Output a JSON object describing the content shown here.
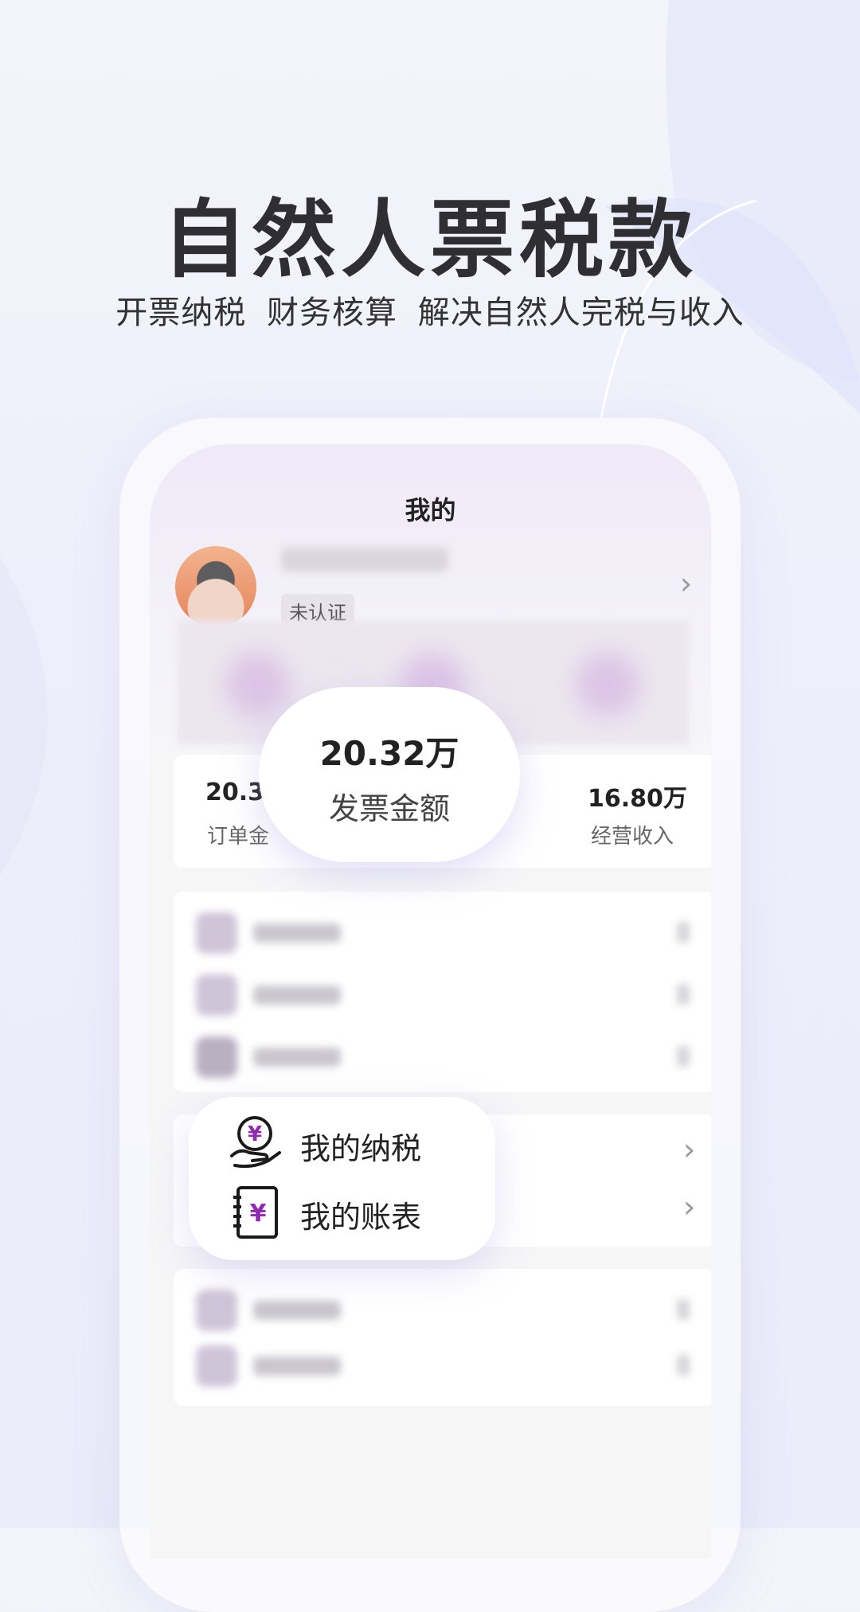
{
  "hero": {
    "title": "自然人票税款",
    "subtitle": "开票纳税  财务核算  解决自然人完税与收入"
  },
  "screen": {
    "title": "我的",
    "user": {
      "name": "",
      "status_badge": "未认证"
    },
    "stats": {
      "left": {
        "value": "20.3",
        "label": "订单金"
      },
      "right": {
        "value": "16.80万",
        "label": "经营收入"
      }
    }
  },
  "highlight_bubble": {
    "value": "20.32万",
    "label": "发票金额"
  },
  "highlight_menu": {
    "items": [
      {
        "label": "我的纳税",
        "icon": "tax-hand-icon"
      },
      {
        "label": "我的账表",
        "icon": "ledger-book-icon"
      }
    ]
  },
  "colors": {
    "accent": "#8e2bb0",
    "ink": "#1a1a1a"
  }
}
